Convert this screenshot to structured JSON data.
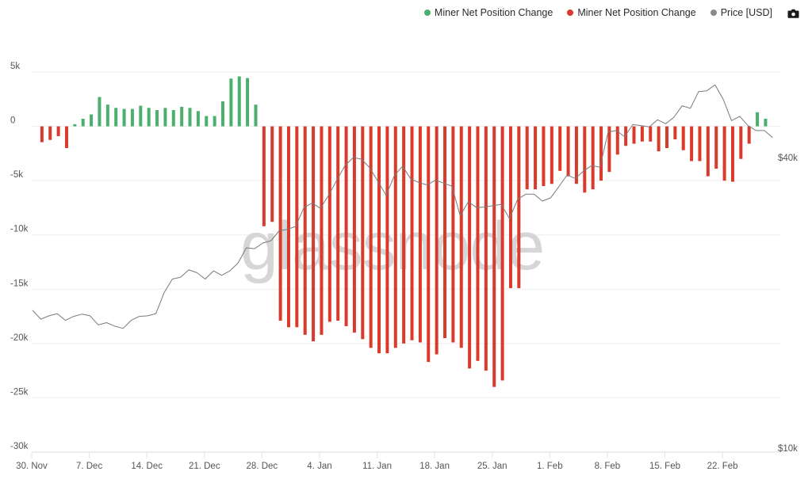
{
  "legend": {
    "items": [
      {
        "label": "Miner Net Position Change",
        "color": "#4caf6e",
        "icon": "green-dot-icon"
      },
      {
        "label": "Miner Net Position Change",
        "color": "#d93a2b",
        "icon": "red-dot-icon"
      },
      {
        "label": "Price [USD]",
        "color": "#8a8a8a",
        "icon": "gray-dot-icon"
      }
    ],
    "camera_icon": "camera-icon"
  },
  "watermark": "glassnode",
  "chart_data": {
    "type": "bar",
    "title": "",
    "xlabel": "",
    "ylabel": "",
    "grid": true,
    "legend_position": "top-right",
    "x_start": "2020-11-30",
    "x_tick_labels": [
      "30. Nov",
      "7. Dec",
      "14. Dec",
      "21. Dec",
      "28. Dec",
      "4. Jan",
      "11. Jan",
      "18. Jan",
      "25. Jan",
      "1. Feb",
      "8. Feb",
      "15. Feb",
      "22. Feb"
    ],
    "x_tick_day_offsets": [
      0,
      7,
      14,
      21,
      28,
      35,
      42,
      49,
      56,
      63,
      70,
      77,
      84
    ],
    "y_left": {
      "ylim": [
        -30000,
        5000
      ],
      "ticks": [
        5000,
        0,
        -5000,
        -10000,
        -15000,
        -20000,
        -25000,
        -30000
      ],
      "tick_labels": [
        "5k",
        "0",
        "-5k",
        "-10k",
        "-15k",
        "-20k",
        "-25k",
        "-30k"
      ]
    },
    "y_right": {
      "scale": "log",
      "ylim": [
        10000,
        40000
      ],
      "ticks": [
        40000,
        10000
      ],
      "tick_labels": [
        "$40k",
        "$10k"
      ]
    },
    "series": [
      {
        "name": "Miner Net Position Change",
        "type": "bar",
        "axis": "left",
        "positive_color": "#4caf6e",
        "negative_color": "#d93a2b",
        "start_day_offset": 1,
        "values": [
          -1460,
          -1250,
          -900,
          -2000,
          200,
          700,
          1100,
          2700,
          2000,
          1700,
          1600,
          1600,
          1900,
          1700,
          1500,
          1700,
          1500,
          1800,
          1700,
          1400,
          950,
          950,
          2300,
          4400,
          4600,
          4450,
          2000,
          -9200,
          -8800,
          -17900,
          -18500,
          -18500,
          -19200,
          -19800,
          -19200,
          -18000,
          -17900,
          -18400,
          -19000,
          -19600,
          -20400,
          -20900,
          -20900,
          -20400,
          -20000,
          -19700,
          -19900,
          -21700,
          -21000,
          -19500,
          -19900,
          -20400,
          -22300,
          -21600,
          -22500,
          -24000,
          -23400,
          -14900,
          -14900,
          -5800,
          -5800,
          -5500,
          -5300,
          -4100,
          -4600,
          -5300,
          -6100,
          -5800,
          -5000,
          -4200,
          -2600,
          -1800,
          -1600,
          -1400,
          -1400,
          -2300,
          -2000,
          -1200,
          -2200,
          -3200,
          -3200,
          -4600,
          -3900,
          -5000,
          -5100,
          -3000,
          -1600,
          1300,
          700
        ]
      },
      {
        "name": "Price [USD]",
        "type": "line",
        "axis": "right",
        "color": "#7a7a7a",
        "start_day_offset": 0,
        "values": [
          19300,
          18500,
          18800,
          19000,
          18400,
          18750,
          18950,
          18800,
          18000,
          18200,
          17900,
          17700,
          18400,
          18750,
          18800,
          19000,
          21000,
          22400,
          22600,
          23400,
          23100,
          22400,
          23300,
          22800,
          23300,
          24200,
          26000,
          25900,
          26600,
          26900,
          28200,
          28400,
          28800,
          31500,
          32200,
          31400,
          33400,
          35900,
          38500,
          40000,
          39700,
          38100,
          35700,
          33400,
          36700,
          38400,
          36100,
          35500,
          35100,
          35900,
          35400,
          34900,
          30300,
          32400,
          31500,
          31600,
          31800,
          32000,
          29900,
          32800,
          33600,
          33600,
          32500,
          33000,
          34800,
          36800,
          36200,
          37500,
          38500,
          38200,
          45200,
          45500,
          44200,
          46800,
          46600,
          46300,
          47900,
          47000,
          48500,
          51200,
          50600,
          54800,
          55000,
          56600,
          52800,
          47700,
          48700,
          46600,
          45500,
          45500,
          44000
        ]
      }
    ]
  }
}
